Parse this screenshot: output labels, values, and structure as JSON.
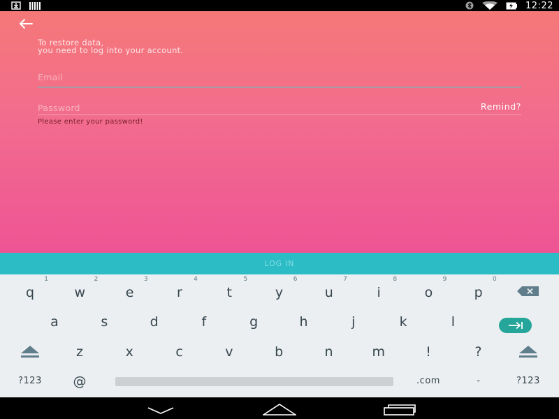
{
  "status_bar": {
    "time": "12:22",
    "left_icons": [
      "download-icon",
      "barcode-icon"
    ],
    "right_icons": [
      "bluetooth-icon",
      "wifi-icon",
      "battery-charging-icon"
    ]
  },
  "app": {
    "back_icon": "arrow-left-icon",
    "message_line1": "To restore data,",
    "message_line2": "you need to log into your account.",
    "email_placeholder": "Email",
    "email_value": "",
    "password_placeholder": "Password",
    "password_value": "",
    "remind_label": "Remind?",
    "password_error": "Please enter your password!",
    "login_label": "LOG IN",
    "colors": {
      "gradient_top": "#f57878",
      "gradient_bottom": "#ee5494",
      "login_button": "#2bbcc6",
      "keyboard_bg": "#eceff1",
      "enter_key": "#26a69a"
    }
  },
  "keyboard": {
    "row1": [
      {
        "label": "q",
        "hint": "1"
      },
      {
        "label": "w",
        "hint": "2"
      },
      {
        "label": "e",
        "hint": "3"
      },
      {
        "label": "r",
        "hint": "4"
      },
      {
        "label": "t",
        "hint": "5"
      },
      {
        "label": "y",
        "hint": "6"
      },
      {
        "label": "u",
        "hint": "7"
      },
      {
        "label": "i",
        "hint": "8"
      },
      {
        "label": "o",
        "hint": "9"
      },
      {
        "label": "p",
        "hint": "0"
      }
    ],
    "row2": [
      "a",
      "s",
      "d",
      "f",
      "g",
      "h",
      "j",
      "k",
      "l"
    ],
    "row3": [
      "z",
      "x",
      "c",
      "v",
      "b",
      "n",
      "m",
      "!",
      "?"
    ],
    "symbols_left": "?123",
    "at": "@",
    "dotcom": ".com",
    "dash": "-",
    "symbols_right": "?123",
    "icons": {
      "backspace": "backspace-icon",
      "enter": "tab-next-icon",
      "shift": "shift-icon"
    }
  },
  "nav_bar": {
    "icons": [
      "hide-keyboard-icon",
      "home-icon",
      "recents-icon"
    ]
  }
}
